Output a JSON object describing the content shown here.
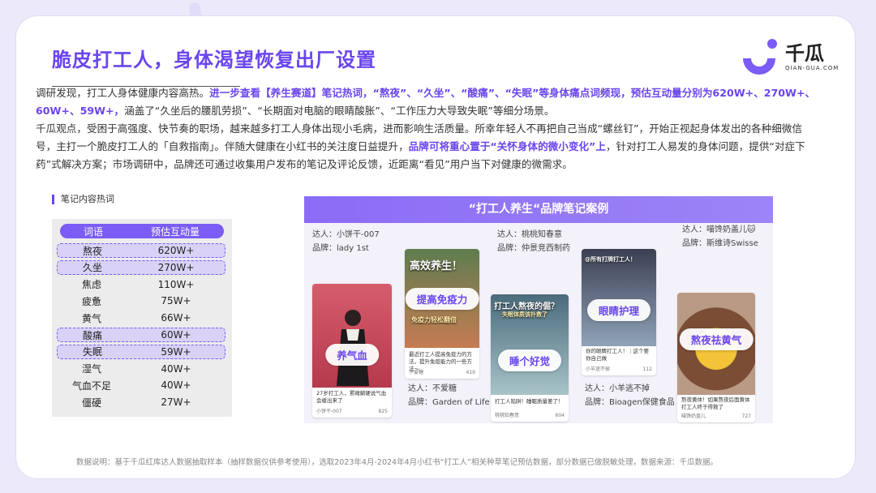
{
  "header": {
    "title": "脆皮打工人，身体渴望恢复出厂设置",
    "logo_cn": "千瓜",
    "logo_en": "QIAN-GUA.COM"
  },
  "paragraph1": {
    "t1": "调研发现，打工人身体健康内容高热。",
    "t2": "进一步查看【养生赛道】笔记热词，“熬夜”、“久坐”、“酸痛”、“失眠”等身体痛点词频现，预估互动量分别为620W+、270W+、60W+、59W+，",
    "t3": "涵盖了“久坐后的腰肌劳损”、“长期面对电脑的眼睛酸胀”、“工作压力大导致失眠”等细分场景。"
  },
  "paragraph2": {
    "t1": "千瓜观点，受困于高强度、快节奏的职场，越来越多打工人身体出现小毛病，进而影响生活质量。所幸年轻人不再把自己当成“螺丝钉”，开始正视起身体发出的各种细微信号，主打一个脆皮打工人的「自救指南」。伴随大健康在小红书的关注度日益提升，",
    "t2": "品牌可将重心置于“关怀身体的微小变化”上",
    "t3": "，针对打工人易发的身体问题，提供“对症下药”式解决方案；市场调研中，品牌还可通过收集用户发布的笔记及评论反馈，近距离“看见”用户当下对健康的微需求。"
  },
  "table": {
    "section_label": "笔记内容热词",
    "col_word": "词语",
    "col_value": "预估互动量",
    "rows": [
      {
        "word": "熬夜",
        "value": "620W+",
        "highlight": true
      },
      {
        "word": "久坐",
        "value": "270W+",
        "highlight": true
      },
      {
        "word": "焦虑",
        "value": "110W+",
        "highlight": false
      },
      {
        "word": "疲惫",
        "value": "75W+",
        "highlight": false
      },
      {
        "word": "黄气",
        "value": "66W+",
        "highlight": false
      },
      {
        "word": "酸痛",
        "value": "60W+",
        "highlight": true
      },
      {
        "word": "失眠",
        "value": "59W+",
        "highlight": true
      },
      {
        "word": "湿气",
        "value": "40W+",
        "highlight": false
      },
      {
        "word": "气血不足",
        "value": "40W+",
        "highlight": false
      },
      {
        "word": "僵硬",
        "value": "27W+",
        "highlight": false
      }
    ]
  },
  "cases": {
    "title": "“打工人养生“品牌笔记案例",
    "items": [
      {
        "influencer": "达人：小饼干-007",
        "brand": "品牌：lady 1st",
        "tag": "养气血",
        "caption": "27岁打工人，累瘫躺硬说气血会缓出来了",
        "author": "小饼干-007",
        "count": "825"
      },
      {
        "influencer": "",
        "brand": "",
        "tag": "提高免疫力",
        "overlay": "高效养生！",
        "sub_overlay": "免疫力轻松翻倍",
        "caption": "最近打工人提高免疫力的方法，提升免疫能力的一些方法～",
        "author": "不爱糖",
        "count": "419",
        "under_influencer": "达人：不爱糖",
        "under_brand": "品牌：Garden of Life"
      },
      {
        "influencer": "达人：桃桃知春意",
        "brand": "品牌：仲景竞西制药",
        "tag": "睡个好觉",
        "overlay": "打工人熬夜的倔？",
        "sub_overlay": "失眠体质该扑救了",
        "caption": "打工人陷阱！睡眠质量差了！",
        "author": "桃桃知春意",
        "count": "604"
      },
      {
        "influencer": "",
        "brand": "",
        "tag": "眼睛护理",
        "overlay": "@所有打牌打工人！",
        "caption": "你的眼睛打工人！｜这个要你自己做",
        "author": "小羊迷不掉",
        "count": "112",
        "under_influencer": "达人：小羊逃不掉",
        "under_brand": "品牌：Bioagen保健食品"
      },
      {
        "influencer": "达人：喵馋奶盖儿🐱",
        "brand": "品牌：斯维诗Swisse",
        "tag": "熬夜祛黄气",
        "caption": "熬夜黄体！如果熬夜后面黄体打工人终于得救了",
        "author": "喵馋奶盖儿",
        "count": "727"
      }
    ]
  },
  "source_note": "数据说明：基于千瓜红库达人数据抽取样本（抽样数据仅供参考使用），选取2023年4月-2024年4月小红书“打工人”相关种草笔记预估数据，部分数据已做脱敏处理，数据来源：千瓜数据。",
  "colors": {
    "accent": "#6a45ee",
    "header_bar": "#8a6cf6",
    "table_bg": "#ececec"
  }
}
